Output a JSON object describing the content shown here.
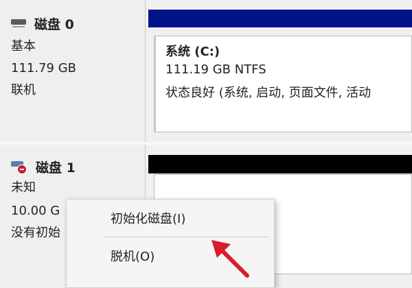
{
  "disks": [
    {
      "title": "磁盘 0",
      "type": "基本",
      "size": "111.79 GB",
      "status": "联机",
      "icon": "hdd-icon",
      "partition": {
        "name": "系统 (C:)",
        "size_fs": "111.19 GB NTFS",
        "health": "状态良好 (系统, 启动, 页面文件, 活动"
      }
    },
    {
      "title": "磁盘 1",
      "type": "未知",
      "size": "10.00 G",
      "status": "没有初始",
      "icon": "disk-unknown-icon"
    }
  ],
  "context_menu": {
    "items": [
      "初始化磁盘(I)",
      "脱机(O)"
    ]
  },
  "colors": {
    "partition_header_primary": "#00138a",
    "unallocated_header": "#000000",
    "arrow": "#d81c2a"
  }
}
